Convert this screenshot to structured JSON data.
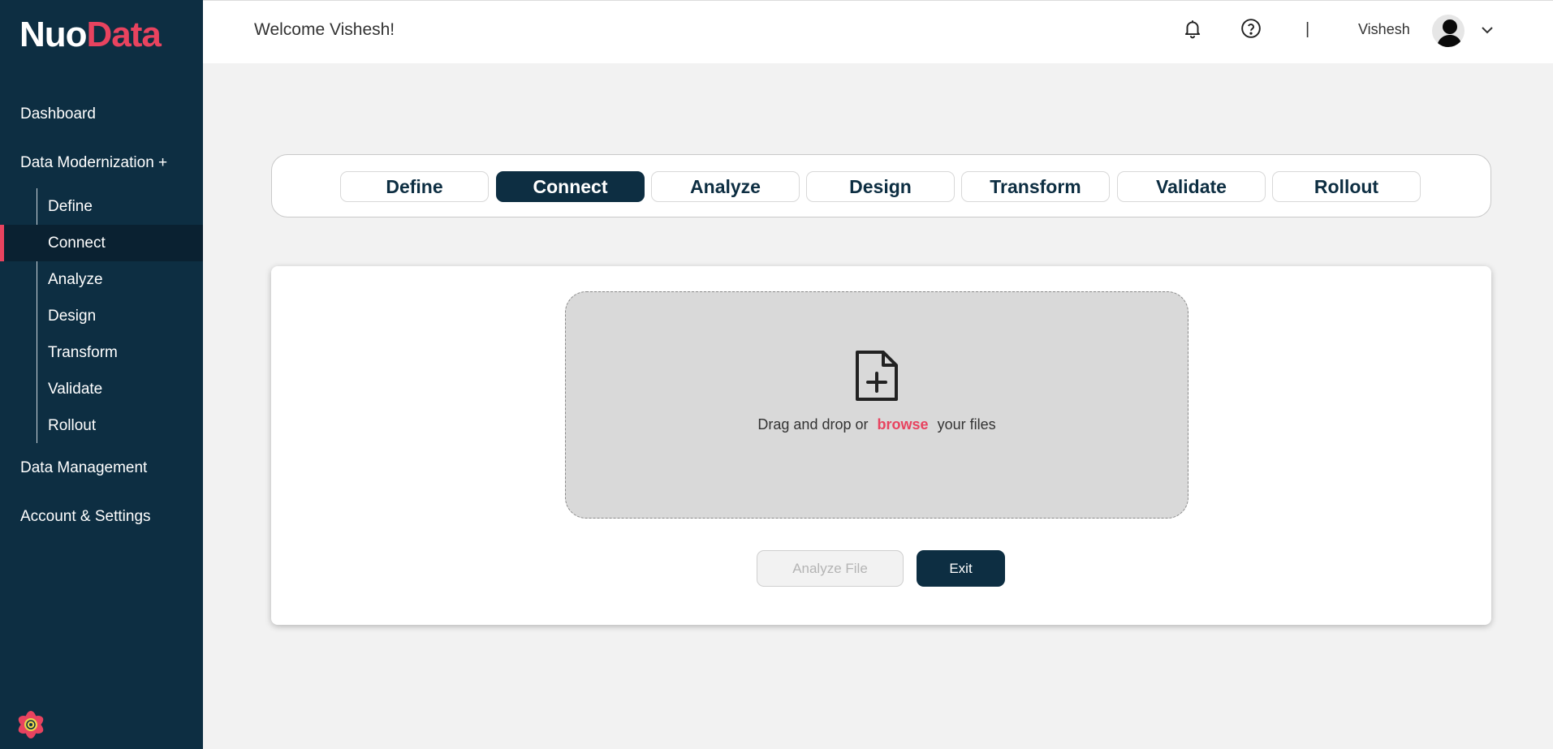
{
  "brand": {
    "logo_part1": "Nuo",
    "logo_part2": "Data",
    "accent_color": "#e8435f",
    "navy_color": "#0d2e42"
  },
  "sidebar": {
    "dashboard": "Dashboard",
    "data_modernization": "Data Modernization +",
    "sub_items": [
      "Define",
      "Connect",
      "Analyze",
      "Design",
      "Transform",
      "Validate",
      "Rollout"
    ],
    "active_item": "Connect",
    "data_management": "Data Management",
    "account_settings": "Account & Settings",
    "footer_icon": "flower-logo-icon"
  },
  "header": {
    "welcome": "Welcome Vishesh!",
    "separator": "|",
    "username": "Vishesh",
    "icons": [
      "bell-icon",
      "help-icon",
      "avatar",
      "chevron-down-icon"
    ]
  },
  "stepper": {
    "steps": [
      "Define",
      "Connect",
      "Analyze",
      "Design",
      "Transform",
      "Validate",
      "Rollout"
    ],
    "active_step": "Connect"
  },
  "upload": {
    "icon": "file-plus-icon",
    "text_before": "Drag and drop or",
    "browse_link": "browse",
    "text_after": "your files"
  },
  "buttons": {
    "analyze": "Analyze File",
    "analyze_disabled": true,
    "exit": "Exit"
  }
}
